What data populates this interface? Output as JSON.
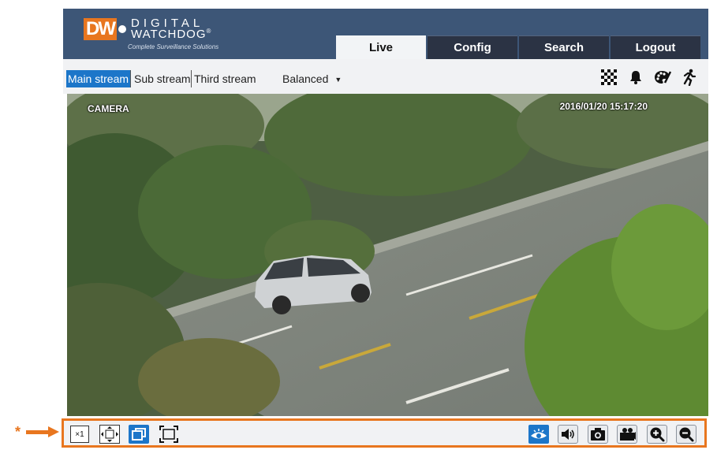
{
  "header": {
    "logo": {
      "mark": "DW",
      "line1": "DIGITAL",
      "line2": "WATCHDOG",
      "registered": "®",
      "tagline": "Complete Surveillance Solutions"
    },
    "tabs": [
      {
        "label": "Live",
        "active": true
      },
      {
        "label": "Config",
        "active": false
      },
      {
        "label": "Search",
        "active": false
      },
      {
        "label": "Logout",
        "active": false
      }
    ]
  },
  "streams": {
    "main": "Main stream",
    "sub": "Sub stream",
    "third": "Third stream",
    "selected": "Main stream",
    "quality": "Balanced"
  },
  "top_icons": [
    "checkerboard-icon",
    "bell-icon",
    "palette-icon",
    "running-person-icon"
  ],
  "video": {
    "camera_label": "CAMERA",
    "timestamp": "2016/01/20  15:17:20"
  },
  "toolbar": {
    "left": [
      "original-size-icon",
      "fit-window-icon",
      "window-mode-icon",
      "fullscreen-icon"
    ],
    "original_size_label": "×1",
    "right": [
      "eye-icon",
      "audio-icon",
      "snapshot-icon",
      "record-icon",
      "zoom-in-icon",
      "zoom-out-icon"
    ]
  },
  "annotation": {
    "marker": "*"
  },
  "colors": {
    "header": "#3d5677",
    "tab": "#2b3344",
    "accent": "#1c76c9",
    "highlight": "#e8761f"
  }
}
